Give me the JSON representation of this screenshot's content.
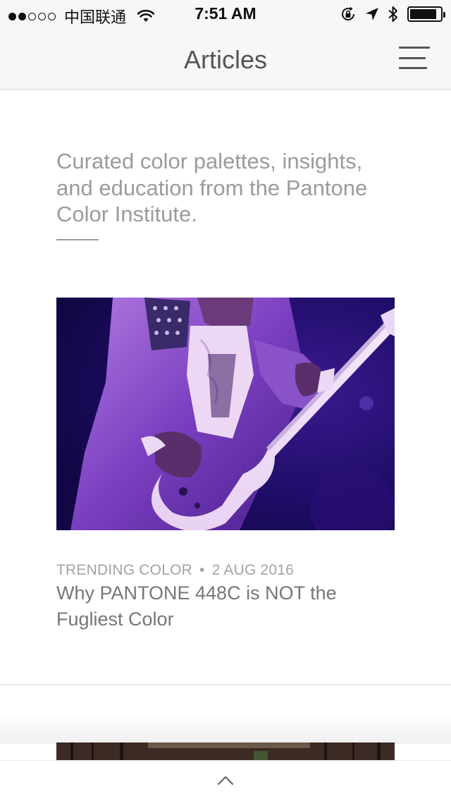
{
  "status_bar": {
    "carrier": "中国联通",
    "time": "7:51 AM",
    "signal_dots_filled": 2,
    "signal_dots_total": 5,
    "battery_level": 0.88,
    "icons": [
      "wifi-icon",
      "rotation-lock-icon",
      "location-arrow-icon",
      "bluetooth-icon",
      "battery-icon"
    ]
  },
  "nav": {
    "title": "Articles",
    "menu_icon": "hamburger-menu-icon"
  },
  "intro": {
    "text": "Curated color palettes, insights, and education from the Pantone Color Institute."
  },
  "articles": [
    {
      "category": "TRENDING COLOR",
      "separator": "•",
      "date": "2 AUG 2016",
      "title": "Why PANTONE 448C is NOT the Fugliest Color",
      "image": "purple-guitarist-photo"
    }
  ],
  "bottom_bar": {
    "icon": "chevron-up-icon"
  },
  "colors": {
    "bar_background": "#f7f7f7",
    "intro_text": "#9b9b9b",
    "title_text": "#777777",
    "photo_purple": "#5a2aa6"
  }
}
